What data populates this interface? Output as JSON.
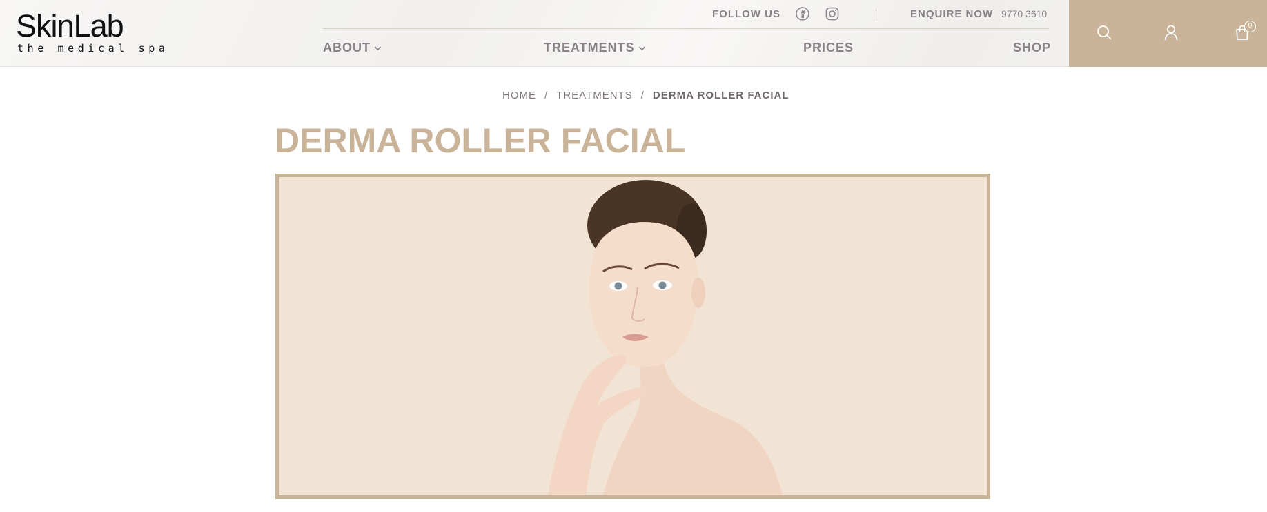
{
  "brand": {
    "name": "SkinLab",
    "tagline": "the medical spa"
  },
  "topbar": {
    "follow_label": "FOLLOW US",
    "social": [
      "facebook-icon",
      "instagram-icon"
    ],
    "enquire_label": "ENQUIRE NOW",
    "phone": "9770 3610"
  },
  "nav": {
    "items": [
      {
        "label": "ABOUT",
        "has_dropdown": true
      },
      {
        "label": "TREATMENTS",
        "has_dropdown": true
      },
      {
        "label": "PRICES",
        "has_dropdown": false
      },
      {
        "label": "SHOP",
        "has_dropdown": false
      }
    ]
  },
  "actions": {
    "icons": [
      "search-icon",
      "user-icon",
      "cart-icon"
    ],
    "cart_count": "0",
    "bg_color": "#c9b49a"
  },
  "breadcrumb": {
    "home": "HOME",
    "sep": "/",
    "treatments": "TREATMENTS",
    "current": "DERMA ROLLER FACIAL"
  },
  "page": {
    "title": "DERMA ROLLER FACIAL",
    "accent_color": "#c9b49a",
    "hero_bg": "#f1e4d4"
  }
}
